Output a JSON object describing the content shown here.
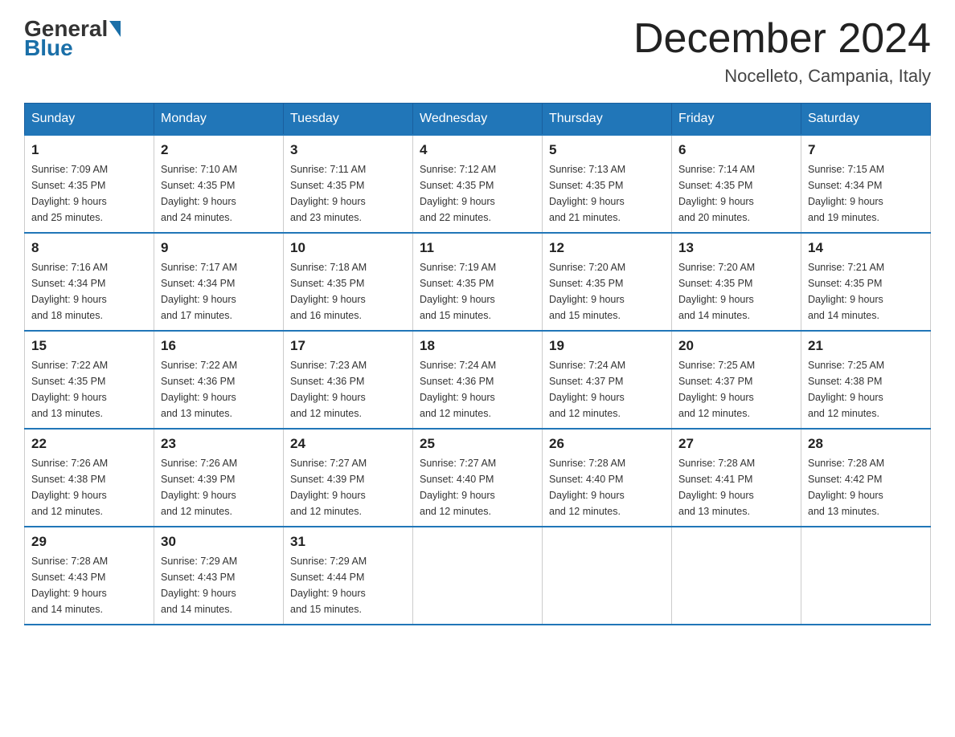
{
  "header": {
    "logo_general": "General",
    "logo_blue": "Blue",
    "month_title": "December 2024",
    "location": "Nocelleto, Campania, Italy"
  },
  "days_of_week": [
    "Sunday",
    "Monday",
    "Tuesday",
    "Wednesday",
    "Thursday",
    "Friday",
    "Saturday"
  ],
  "weeks": [
    [
      {
        "day": "1",
        "sunrise": "7:09 AM",
        "sunset": "4:35 PM",
        "daylight": "9 hours and 25 minutes."
      },
      {
        "day": "2",
        "sunrise": "7:10 AM",
        "sunset": "4:35 PM",
        "daylight": "9 hours and 24 minutes."
      },
      {
        "day": "3",
        "sunrise": "7:11 AM",
        "sunset": "4:35 PM",
        "daylight": "9 hours and 23 minutes."
      },
      {
        "day": "4",
        "sunrise": "7:12 AM",
        "sunset": "4:35 PM",
        "daylight": "9 hours and 22 minutes."
      },
      {
        "day": "5",
        "sunrise": "7:13 AM",
        "sunset": "4:35 PM",
        "daylight": "9 hours and 21 minutes."
      },
      {
        "day": "6",
        "sunrise": "7:14 AM",
        "sunset": "4:35 PM",
        "daylight": "9 hours and 20 minutes."
      },
      {
        "day": "7",
        "sunrise": "7:15 AM",
        "sunset": "4:34 PM",
        "daylight": "9 hours and 19 minutes."
      }
    ],
    [
      {
        "day": "8",
        "sunrise": "7:16 AM",
        "sunset": "4:34 PM",
        "daylight": "9 hours and 18 minutes."
      },
      {
        "day": "9",
        "sunrise": "7:17 AM",
        "sunset": "4:34 PM",
        "daylight": "9 hours and 17 minutes."
      },
      {
        "day": "10",
        "sunrise": "7:18 AM",
        "sunset": "4:35 PM",
        "daylight": "9 hours and 16 minutes."
      },
      {
        "day": "11",
        "sunrise": "7:19 AM",
        "sunset": "4:35 PM",
        "daylight": "9 hours and 15 minutes."
      },
      {
        "day": "12",
        "sunrise": "7:20 AM",
        "sunset": "4:35 PM",
        "daylight": "9 hours and 15 minutes."
      },
      {
        "day": "13",
        "sunrise": "7:20 AM",
        "sunset": "4:35 PM",
        "daylight": "9 hours and 14 minutes."
      },
      {
        "day": "14",
        "sunrise": "7:21 AM",
        "sunset": "4:35 PM",
        "daylight": "9 hours and 14 minutes."
      }
    ],
    [
      {
        "day": "15",
        "sunrise": "7:22 AM",
        "sunset": "4:35 PM",
        "daylight": "9 hours and 13 minutes."
      },
      {
        "day": "16",
        "sunrise": "7:22 AM",
        "sunset": "4:36 PM",
        "daylight": "9 hours and 13 minutes."
      },
      {
        "day": "17",
        "sunrise": "7:23 AM",
        "sunset": "4:36 PM",
        "daylight": "9 hours and 12 minutes."
      },
      {
        "day": "18",
        "sunrise": "7:24 AM",
        "sunset": "4:36 PM",
        "daylight": "9 hours and 12 minutes."
      },
      {
        "day": "19",
        "sunrise": "7:24 AM",
        "sunset": "4:37 PM",
        "daylight": "9 hours and 12 minutes."
      },
      {
        "day": "20",
        "sunrise": "7:25 AM",
        "sunset": "4:37 PM",
        "daylight": "9 hours and 12 minutes."
      },
      {
        "day": "21",
        "sunrise": "7:25 AM",
        "sunset": "4:38 PM",
        "daylight": "9 hours and 12 minutes."
      }
    ],
    [
      {
        "day": "22",
        "sunrise": "7:26 AM",
        "sunset": "4:38 PM",
        "daylight": "9 hours and 12 minutes."
      },
      {
        "day": "23",
        "sunrise": "7:26 AM",
        "sunset": "4:39 PM",
        "daylight": "9 hours and 12 minutes."
      },
      {
        "day": "24",
        "sunrise": "7:27 AM",
        "sunset": "4:39 PM",
        "daylight": "9 hours and 12 minutes."
      },
      {
        "day": "25",
        "sunrise": "7:27 AM",
        "sunset": "4:40 PM",
        "daylight": "9 hours and 12 minutes."
      },
      {
        "day": "26",
        "sunrise": "7:28 AM",
        "sunset": "4:40 PM",
        "daylight": "9 hours and 12 minutes."
      },
      {
        "day": "27",
        "sunrise": "7:28 AM",
        "sunset": "4:41 PM",
        "daylight": "9 hours and 13 minutes."
      },
      {
        "day": "28",
        "sunrise": "7:28 AM",
        "sunset": "4:42 PM",
        "daylight": "9 hours and 13 minutes."
      }
    ],
    [
      {
        "day": "29",
        "sunrise": "7:28 AM",
        "sunset": "4:43 PM",
        "daylight": "9 hours and 14 minutes."
      },
      {
        "day": "30",
        "sunrise": "7:29 AM",
        "sunset": "4:43 PM",
        "daylight": "9 hours and 14 minutes."
      },
      {
        "day": "31",
        "sunrise": "7:29 AM",
        "sunset": "4:44 PM",
        "daylight": "9 hours and 15 minutes."
      },
      null,
      null,
      null,
      null
    ]
  ],
  "labels": {
    "sunrise": "Sunrise:",
    "sunset": "Sunset:",
    "daylight": "Daylight:"
  }
}
